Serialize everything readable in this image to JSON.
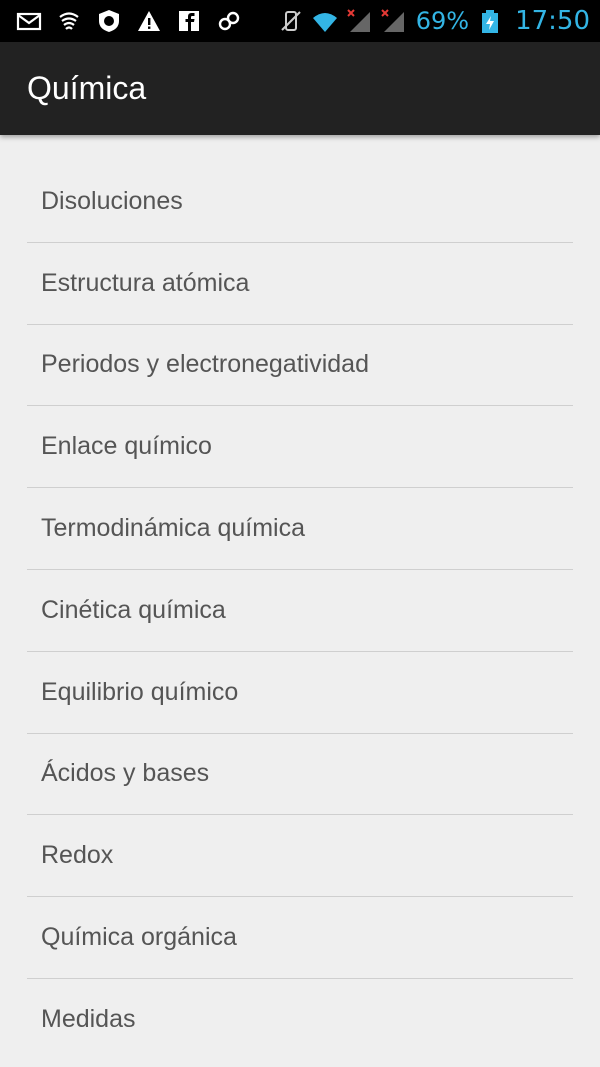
{
  "status_bar": {
    "left_icons": [
      "gmail-icon",
      "cast-icon",
      "shield-icon",
      "warning-icon",
      "facebook-icon",
      "link-icon"
    ],
    "right_icons": [
      "vibrate-off-icon",
      "wifi-icon",
      "signal-no-service-icon",
      "signal-no-service-icon"
    ],
    "battery_percent": "69%",
    "time": "17:50",
    "accent_color": "#33b5e5"
  },
  "action_bar": {
    "title": "Química",
    "background": "#222222"
  },
  "list": {
    "items": [
      {
        "label": "Disoluciones"
      },
      {
        "label": "Estructura atómica"
      },
      {
        "label": "Periodos y electronegatividad"
      },
      {
        "label": "Enlace químico"
      },
      {
        "label": "Termodinámica química"
      },
      {
        "label": "Cinética química"
      },
      {
        "label": "Equilibrio químico"
      },
      {
        "label": "Ácidos y bases"
      },
      {
        "label": "Redox"
      },
      {
        "label": "Química orgánica"
      },
      {
        "label": "Medidas"
      }
    ]
  }
}
